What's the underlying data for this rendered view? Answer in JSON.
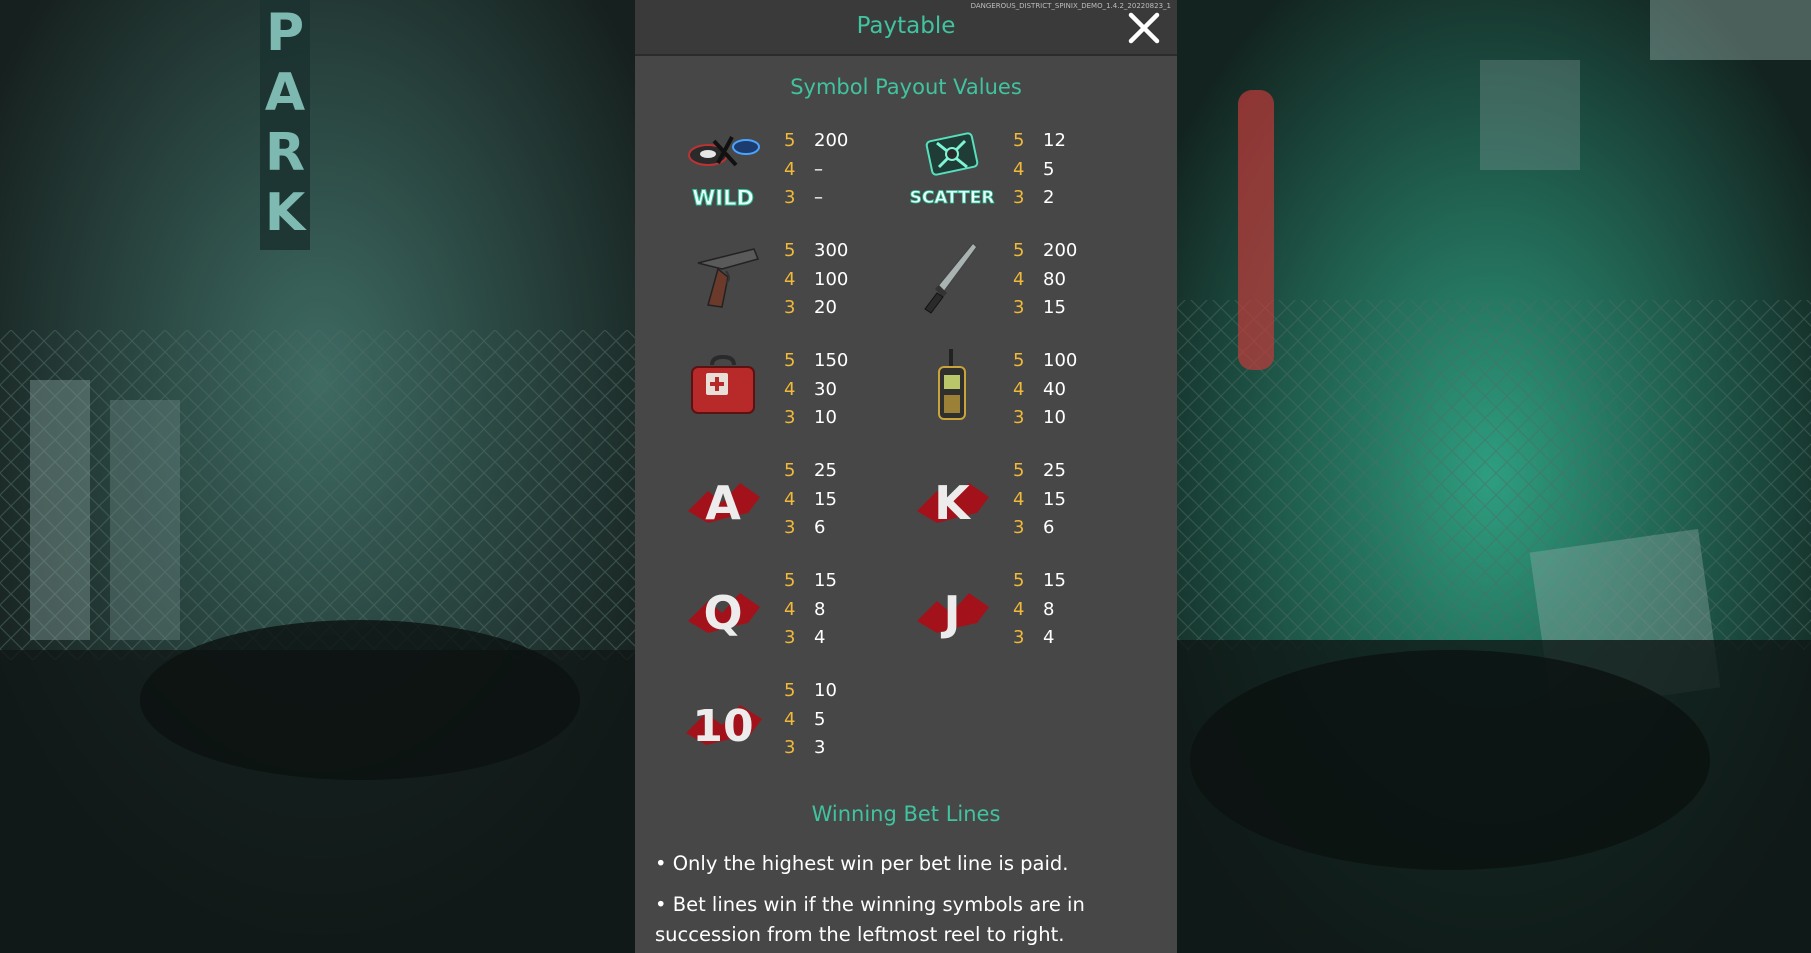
{
  "version_text": "DANGEROUS_DISTRICT_SPINIX_DEMO_1.4.2_20220823_1",
  "header": {
    "title": "Paytable",
    "close_icon": "close-x-icon"
  },
  "symbol_section": {
    "heading": "Symbol Payout Values",
    "symbols": [
      {
        "key": "wild",
        "icon": "wild-icon",
        "label": "WILD",
        "pays": [
          {
            "count": "5",
            "value": "200"
          },
          {
            "count": "4",
            "value": "–"
          },
          {
            "count": "3",
            "value": "–"
          }
        ]
      },
      {
        "key": "scatter",
        "icon": "scatter-icon",
        "label": "SCATTER",
        "pays": [
          {
            "count": "5",
            "value": "12"
          },
          {
            "count": "4",
            "value": "5"
          },
          {
            "count": "3",
            "value": "2"
          }
        ]
      },
      {
        "key": "pistol",
        "icon": "pistol-icon",
        "pays": [
          {
            "count": "5",
            "value": "300"
          },
          {
            "count": "4",
            "value": "100"
          },
          {
            "count": "3",
            "value": "20"
          }
        ]
      },
      {
        "key": "knife",
        "icon": "knife-icon",
        "pays": [
          {
            "count": "5",
            "value": "200"
          },
          {
            "count": "4",
            "value": "80"
          },
          {
            "count": "3",
            "value": "15"
          }
        ]
      },
      {
        "key": "medkit",
        "icon": "medkit-icon",
        "pays": [
          {
            "count": "5",
            "value": "150"
          },
          {
            "count": "4",
            "value": "30"
          },
          {
            "count": "3",
            "value": "10"
          }
        ]
      },
      {
        "key": "radio",
        "icon": "walkie-talkie-icon",
        "pays": [
          {
            "count": "5",
            "value": "100"
          },
          {
            "count": "4",
            "value": "40"
          },
          {
            "count": "3",
            "value": "10"
          }
        ]
      },
      {
        "key": "ace",
        "icon": "ace-icon",
        "label": "A",
        "pays": [
          {
            "count": "5",
            "value": "25"
          },
          {
            "count": "4",
            "value": "15"
          },
          {
            "count": "3",
            "value": "6"
          }
        ]
      },
      {
        "key": "king",
        "icon": "king-icon",
        "label": "K",
        "pays": [
          {
            "count": "5",
            "value": "25"
          },
          {
            "count": "4",
            "value": "15"
          },
          {
            "count": "3",
            "value": "6"
          }
        ]
      },
      {
        "key": "queen",
        "icon": "queen-icon",
        "label": "Q",
        "pays": [
          {
            "count": "5",
            "value": "15"
          },
          {
            "count": "4",
            "value": "8"
          },
          {
            "count": "3",
            "value": "4"
          }
        ]
      },
      {
        "key": "jack",
        "icon": "jack-icon",
        "label": "J",
        "pays": [
          {
            "count": "5",
            "value": "15"
          },
          {
            "count": "4",
            "value": "8"
          },
          {
            "count": "3",
            "value": "4"
          }
        ]
      },
      {
        "key": "ten",
        "icon": "ten-icon",
        "label": "10",
        "pays": [
          {
            "count": "5",
            "value": "10"
          },
          {
            "count": "4",
            "value": "5"
          },
          {
            "count": "3",
            "value": "3"
          }
        ]
      }
    ]
  },
  "lines_section": {
    "heading": "Winning Bet Lines",
    "rules": [
      "• Only the highest win per bet line is paid.",
      "• Bet lines win if the winning symbols are in succession from the leftmost reel to right."
    ]
  },
  "colors": {
    "accent": "#40c4a0",
    "count": "#f0b93a",
    "panel": "#474747",
    "blood": "#a3121a"
  }
}
